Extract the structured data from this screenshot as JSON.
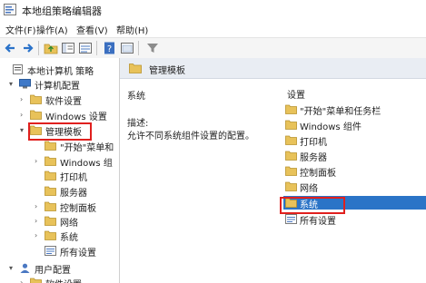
{
  "window": {
    "title": "本地组策略编辑器"
  },
  "menu": [
    "文件(F)",
    "操作(A)",
    "查看(V)",
    "帮助(H)"
  ],
  "toolbar": [
    "back-icon",
    "forward-icon",
    "up-folder-icon",
    "show-hide-tree-icon",
    "export-list-icon",
    "help-icon",
    "properties-icon",
    "filter-icon"
  ],
  "tree": [
    {
      "label": "本地计算机 策略",
      "indent": 0,
      "arrow": "",
      "icon": "policy-icon"
    },
    {
      "label": "计算机配置",
      "indent": 1,
      "arrow": "▾",
      "icon": "computer-icon"
    },
    {
      "label": "软件设置",
      "indent": 2,
      "arrow": "›",
      "icon": "folder-icon"
    },
    {
      "label": "Windows 设置",
      "indent": 2,
      "arrow": "›",
      "icon": "folder-icon"
    },
    {
      "label": "管理模板",
      "indent": 2,
      "arrow": "▾",
      "icon": "folder-open-icon",
      "highlighted": true
    },
    {
      "label": "\"开始\"菜单和",
      "indent": 3,
      "arrow": "",
      "icon": "folder-icon"
    },
    {
      "label": "Windows 组",
      "indent": 3,
      "arrow": "›",
      "icon": "folder-icon"
    },
    {
      "label": "打印机",
      "indent": 3,
      "arrow": "",
      "icon": "folder-icon"
    },
    {
      "label": "服务器",
      "indent": 3,
      "arrow": "",
      "icon": "folder-icon"
    },
    {
      "label": "控制面板",
      "indent": 3,
      "arrow": "›",
      "icon": "folder-icon"
    },
    {
      "label": "网络",
      "indent": 3,
      "arrow": "›",
      "icon": "folder-icon"
    },
    {
      "label": "系统",
      "indent": 3,
      "arrow": "›",
      "icon": "folder-icon"
    },
    {
      "label": "所有设置",
      "indent": 3,
      "arrow": "",
      "icon": "settings-list-icon"
    },
    {
      "label": "用户配置",
      "indent": 1,
      "arrow": "▾",
      "icon": "user-icon"
    },
    {
      "label": "软件设置",
      "indent": 2,
      "arrow": "›",
      "icon": "folder-icon"
    }
  ],
  "right": {
    "header": "管理模板",
    "selected_title": "系统",
    "description_label": "描述:",
    "description": "允许不同系统组件设置的配置。",
    "list_header": "设置",
    "items": [
      {
        "label": "\"开始\"菜单和任务栏",
        "icon": "folder-icon"
      },
      {
        "label": "Windows 组件",
        "icon": "folder-icon"
      },
      {
        "label": "打印机",
        "icon": "folder-icon"
      },
      {
        "label": "服务器",
        "icon": "folder-icon"
      },
      {
        "label": "控制面板",
        "icon": "folder-icon"
      },
      {
        "label": "网络",
        "icon": "folder-icon"
      },
      {
        "label": "系统",
        "icon": "folder-icon",
        "selected": true
      },
      {
        "label": "所有设置",
        "icon": "settings-list-icon"
      }
    ]
  },
  "colors": {
    "highlight": "#e0201e",
    "selection": "#2b74c7",
    "folder": "#e8c25a"
  }
}
